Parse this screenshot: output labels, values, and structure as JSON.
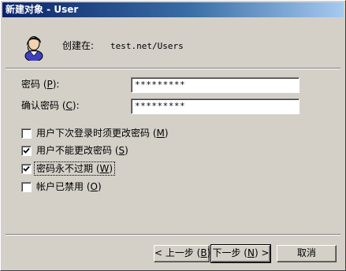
{
  "window": {
    "title": "新建对象 - User"
  },
  "header": {
    "create_in_label": "创建在:",
    "path": "test.net/Users",
    "icon": "user-icon"
  },
  "password": {
    "label_prefix": "密码 (",
    "label_key": "P",
    "label_suffix": "):",
    "value": "*********"
  },
  "confirm_password": {
    "label_prefix": "确认密码 (",
    "label_key": "C",
    "label_suffix": "):",
    "value": "*********"
  },
  "options": [
    {
      "label_prefix": "用户下次登录时须更改密码 (",
      "label_key": "M",
      "label_suffix": ")",
      "checked": false
    },
    {
      "label_prefix": "用户不能更改密码 (",
      "label_key": "S",
      "label_suffix": ")",
      "checked": true
    },
    {
      "label_prefix": "密码永不过期 (",
      "label_key": "W",
      "label_suffix": ")",
      "checked": true
    },
    {
      "label_prefix": "帐户已禁用 (",
      "label_key": "O",
      "label_suffix": ")",
      "checked": false
    }
  ],
  "buttons": {
    "back": {
      "prefix": "< 上一步 (",
      "key": "B",
      "suffix": ")"
    },
    "next": {
      "prefix": "下一步 (",
      "key": "N",
      "suffix": ") >"
    },
    "cancel": {
      "label": "取消"
    }
  }
}
